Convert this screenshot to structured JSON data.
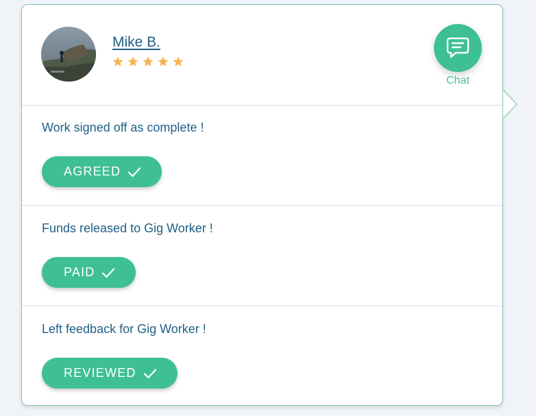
{
  "profile": {
    "name": "Mike B.",
    "rating": 5,
    "star_color": "#f6b552"
  },
  "chat": {
    "label": "Chat",
    "icon": "chat-bubble-icon"
  },
  "steps": [
    {
      "text": "Work signed off as complete !",
      "status": "AGREED"
    },
    {
      "text": "Funds released to Gig Worker !",
      "status": "PAID"
    },
    {
      "text": "Left feedback for Gig Worker !",
      "status": "REVIEWED"
    }
  ],
  "colors": {
    "accent": "#3fbf94",
    "text": "#1f5e86",
    "border": "#7cc8a9"
  }
}
